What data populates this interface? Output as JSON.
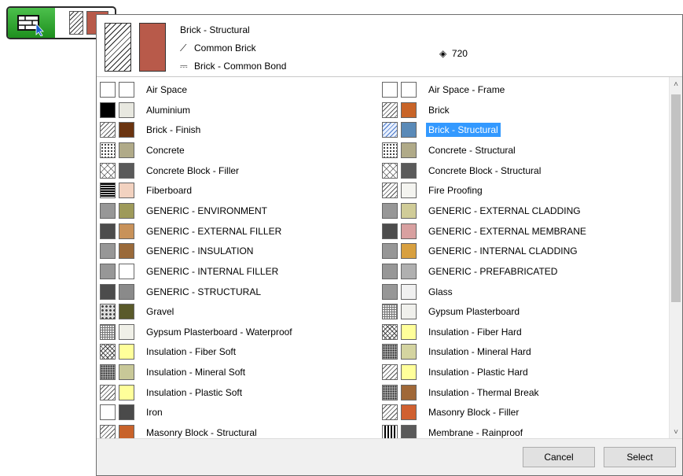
{
  "tool_button": {
    "preview_color": "#b85a4a"
  },
  "header": {
    "material_name": "Brick - Structural",
    "fill_name": "Common Brick",
    "surface_name": "Brick - Common Bond",
    "priority": "720",
    "preview_color": "#b85a4a",
    "fill_icon": "fill-pattern-icon",
    "surface_icon": "paint-bucket-icon",
    "priority_icon": "priority-diamond-icon"
  },
  "materials_left": [
    {
      "name": "Air Space",
      "pattern": "blank",
      "color": "#ffffff"
    },
    {
      "name": "Aluminium",
      "pattern": "solid",
      "color": "#e8e8e0"
    },
    {
      "name": "Brick - Finish",
      "pattern": "diag",
      "color": "#6b3410"
    },
    {
      "name": "Concrete",
      "pattern": "dots",
      "color": "#b0aa88"
    },
    {
      "name": "Concrete Block - Filler",
      "pattern": "cross",
      "color": "#5a5a5a"
    },
    {
      "name": "Fiberboard",
      "pattern": "hline",
      "color": "#f2d2c0"
    },
    {
      "name": "GENERIC - ENVIRONMENT",
      "pattern": "fine",
      "color": "#9e9a5a"
    },
    {
      "name": "GENERIC - EXTERNAL FILLER",
      "pattern": "dark",
      "color": "#c8925a"
    },
    {
      "name": "GENERIC - INSULATION",
      "pattern": "fine",
      "color": "#9a6a3a"
    },
    {
      "name": "GENERIC - INTERNAL FILLER",
      "pattern": "fine",
      "color": "#ffffff"
    },
    {
      "name": "GENERIC - STRUCTURAL",
      "pattern": "dark",
      "color": "#8a8a8a"
    },
    {
      "name": "Gravel",
      "pattern": "gravel",
      "color": "#5a5a2a"
    },
    {
      "name": "Gypsum Plasterboard - Waterproof",
      "pattern": "grid",
      "color": "#f0f0e8"
    },
    {
      "name": "Insulation - Fiber Soft",
      "pattern": "insul",
      "color": "#ffff9a"
    },
    {
      "name": "Insulation - Mineral Soft",
      "pattern": "thermal",
      "color": "#c8c898"
    },
    {
      "name": "Insulation - Plastic Soft",
      "pattern": "diag",
      "color": "#ffff9a"
    },
    {
      "name": "Iron",
      "pattern": "blank",
      "color": "#4a4a4a"
    },
    {
      "name": "Masonry Block - Structural",
      "pattern": "diag",
      "color": "#c8622a"
    }
  ],
  "materials_right": [
    {
      "name": "Air Space - Frame",
      "pattern": "blank",
      "color": "#ffffff"
    },
    {
      "name": "Brick",
      "pattern": "diag",
      "color": "#c86428"
    },
    {
      "name": "Brick - Structural",
      "pattern": "diag-blue",
      "color": "#5a8ab8",
      "selected": true
    },
    {
      "name": "Concrete - Structural",
      "pattern": "dots",
      "color": "#b0aa88"
    },
    {
      "name": "Concrete Block - Structural",
      "pattern": "cross",
      "color": "#5a5a5a"
    },
    {
      "name": "Fire Proofing",
      "pattern": "diag",
      "color": "#f4f4f0"
    },
    {
      "name": "GENERIC - EXTERNAL CLADDING",
      "pattern": "fine",
      "color": "#d0cc98"
    },
    {
      "name": "GENERIC - EXTERNAL MEMBRANE",
      "pattern": "dark",
      "color": "#d8a0a0"
    },
    {
      "name": "GENERIC - INTERNAL CLADDING",
      "pattern": "fine",
      "color": "#d8a040"
    },
    {
      "name": "GENERIC - PREFABRICATED",
      "pattern": "fine",
      "color": "#b0b0b0"
    },
    {
      "name": "Glass",
      "pattern": "fine",
      "color": "#f0f0f0"
    },
    {
      "name": "Gypsum Plasterboard",
      "pattern": "grid",
      "color": "#f0f0ec"
    },
    {
      "name": "Insulation - Fiber Hard",
      "pattern": "insul",
      "color": "#ffff9a"
    },
    {
      "name": "Insulation - Mineral Hard",
      "pattern": "thermal",
      "color": "#d4d4a0"
    },
    {
      "name": "Insulation - Plastic Hard",
      "pattern": "diag",
      "color": "#ffff9a"
    },
    {
      "name": "Insulation - Thermal Break",
      "pattern": "thermal",
      "color": "#a06838"
    },
    {
      "name": "Masonry Block - Filler",
      "pattern": "diag",
      "color": "#d06030"
    },
    {
      "name": "Membrane - Rainproof",
      "pattern": "vline",
      "color": "#5a5a5a"
    }
  ],
  "footer": {
    "cancel_label": "Cancel",
    "select_label": "Select"
  }
}
